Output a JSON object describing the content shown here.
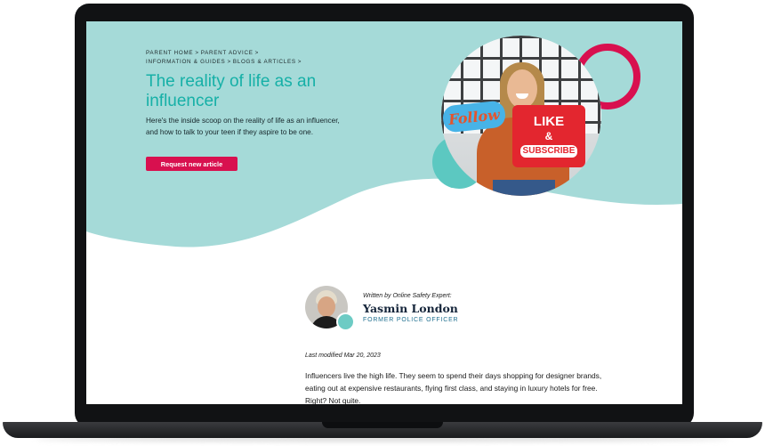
{
  "breadcrumb": {
    "items": [
      "Parent Home",
      "Parent Advice",
      "Information & Guides",
      "Blogs & Articles"
    ],
    "separator": ">"
  },
  "hero": {
    "title": "The reality of life as an influencer",
    "intro": "Here's the inside scoop on the reality of life as an influencer, and how to talk to your teen if they aspire to be one.",
    "cta_label": "Request new article",
    "image": {
      "bubble_text": "Follow",
      "sign_line1": "LIKE",
      "sign_line2": "&",
      "sign_line3": "SUBSCRIBE"
    }
  },
  "author": {
    "written_by": "Written by Online Safety Expert:",
    "name": "Yasmin London",
    "role": "FORMER POLICE OFFICER"
  },
  "article": {
    "last_modified": "Last modified Mar 20, 2023",
    "paragraph1": "Influencers live the high life. They seem to spend their days shopping for designer brands, eating out at expensive restaurants, flying first class, and staying in luxury hotels for free. Right? Not quite."
  },
  "colors": {
    "hero_background": "#a5dad8",
    "accent_teal": "#16b0a7",
    "accent_pink": "#d8104f",
    "laptop_frame": "#111214"
  }
}
